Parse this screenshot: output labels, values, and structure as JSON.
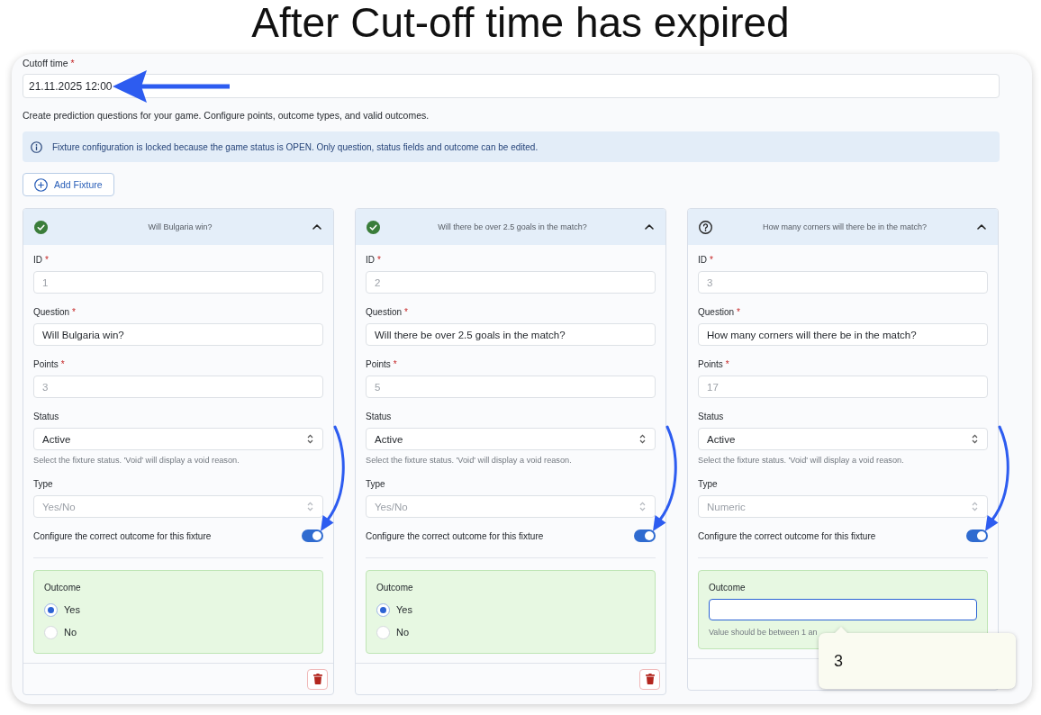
{
  "title": "After Cut-off time has expired",
  "cutoff_time": {
    "label": "Cutoff time",
    "required_mark": "*",
    "value": "21.11.2025 12:00",
    "arrow": true
  },
  "description": "Create prediction questions for your game. Configure points, outcome types, and valid outcomes.",
  "alert": {
    "text": "Fixture configuration is locked because the game status is OPEN. Only question, status fields and outcome can be edited."
  },
  "add_button": {
    "label": "Add Fixture"
  },
  "fixtures": [
    {
      "status_icon": {
        "kind": "check"
      },
      "title": "Will Bulgaria win?",
      "expanded": true,
      "fields": [
        {
          "kind": "input",
          "label": "ID",
          "required_mark": "*",
          "value": "1",
          "disabled": true
        },
        {
          "kind": "input",
          "label": "Question",
          "required_mark": "*",
          "value": "Will Bulgaria win?",
          "disabled": false
        },
        {
          "kind": "input",
          "label": "Points",
          "required_mark": "*",
          "value": "3",
          "disabled": true
        },
        {
          "kind": "select",
          "label": "Status",
          "value": "Active",
          "disabled": false,
          "help": "Select the fixture status. 'Void' will display a void reason."
        },
        {
          "kind": "select",
          "label": "Type",
          "value": "Yes/No",
          "disabled": true
        }
      ],
      "outcome_toggle": {
        "label": "Configure the correct outcome for this fixture",
        "on": true,
        "arrow": true
      },
      "outcome": {
        "kind": "radio",
        "label": "Outcome",
        "options": [
          {
            "label": "Yes",
            "selected": true
          },
          {
            "label": "No",
            "selected": false
          }
        ]
      },
      "footer_actions": [
        {
          "kind": "delete"
        }
      ]
    },
    {
      "status_icon": {
        "kind": "check"
      },
      "title": "Will there be over 2.5 goals in the match?",
      "expanded": true,
      "fields": [
        {
          "kind": "input",
          "label": "ID",
          "required_mark": "*",
          "value": "2",
          "disabled": true
        },
        {
          "kind": "input",
          "label": "Question",
          "required_mark": "*",
          "value": "Will there be over 2.5 goals in the match?",
          "disabled": false
        },
        {
          "kind": "input",
          "label": "Points",
          "required_mark": "*",
          "value": "5",
          "disabled": true
        },
        {
          "kind": "select",
          "label": "Status",
          "value": "Active",
          "disabled": false,
          "help": "Select the fixture status. 'Void' will display a void reason."
        },
        {
          "kind": "select",
          "label": "Type",
          "value": "Yes/No",
          "disabled": true
        }
      ],
      "outcome_toggle": {
        "label": "Configure the correct outcome for this fixture",
        "on": true,
        "arrow": true
      },
      "outcome": {
        "kind": "radio",
        "label": "Outcome",
        "options": [
          {
            "label": "Yes",
            "selected": true
          },
          {
            "label": "No",
            "selected": false
          }
        ]
      },
      "footer_actions": [
        {
          "kind": "delete"
        }
      ]
    },
    {
      "status_icon": {
        "kind": "question"
      },
      "title": "How many corners will there be in the match?",
      "expanded": true,
      "fields": [
        {
          "kind": "input",
          "label": "ID",
          "required_mark": "*",
          "value": "3",
          "disabled": true
        },
        {
          "kind": "input",
          "label": "Question",
          "required_mark": "*",
          "value": "How many corners will there be in the match?",
          "disabled": false
        },
        {
          "kind": "input",
          "label": "Points",
          "required_mark": "*",
          "value": "17",
          "disabled": true
        },
        {
          "kind": "select",
          "label": "Status",
          "value": "Active",
          "disabled": false,
          "help": "Select the fixture status. 'Void' will display a void reason."
        },
        {
          "kind": "select",
          "label": "Type",
          "value": "Numeric",
          "disabled": true
        }
      ],
      "outcome_toggle": {
        "label": "Configure the correct outcome for this fixture",
        "on": true,
        "arrow": true
      },
      "outcome": {
        "kind": "number",
        "label": "Outcome",
        "focused": true,
        "help": "Value should be between 1 an",
        "tooltip": "3"
      }
    }
  ]
}
